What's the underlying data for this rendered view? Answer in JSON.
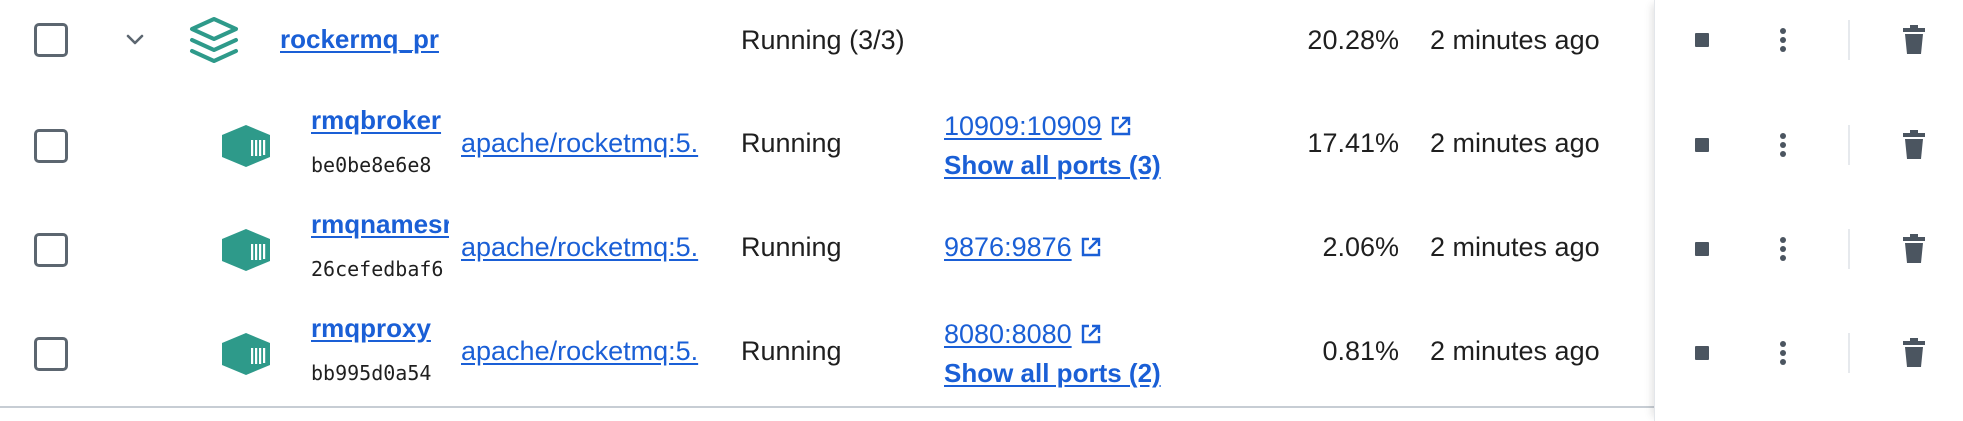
{
  "group": {
    "name": "rockermq_pr",
    "status": "Running (3/3)",
    "cpu": "20.28%",
    "started": "2 minutes ago"
  },
  "containers": [
    {
      "name": "rmqbroker",
      "id": "be0be8e6e8",
      "image": "apache/rocketmq:5.",
      "status": "Running",
      "port": "10909:10909",
      "show_ports": "Show all ports (3)",
      "cpu": "17.41%",
      "started": "2 minutes ago"
    },
    {
      "name": "rmqnamesrv",
      "id": "26cefedbaf6",
      "image": "apache/rocketmq:5.",
      "status": "Running",
      "port": "9876:9876",
      "cpu": "2.06%",
      "started": "2 minutes ago"
    },
    {
      "name": "rmqproxy",
      "id": "bb995d0a54",
      "image": "apache/rocketmq:5.",
      "status": "Running",
      "port": "8080:8080",
      "show_ports": "Show all ports (2)",
      "cpu": "0.81%",
      "started": "2 minutes ago"
    }
  ],
  "icons": {
    "stack": "stack-icon",
    "container": "container-icon",
    "external_link": "external-link-icon",
    "stop": "stop-icon",
    "more": "more-vertical-icon",
    "delete": "trash-icon",
    "expand": "chevron-down-icon"
  },
  "colors": {
    "link": "#1a5fd6",
    "icon_teal": "#2e9a8a",
    "action_gray": "#4b5560",
    "checkbox_border": "#5c6670"
  }
}
